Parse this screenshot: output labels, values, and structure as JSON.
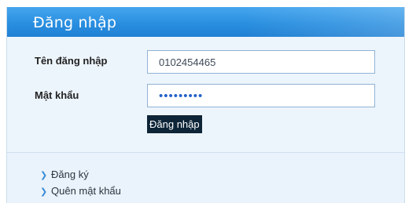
{
  "panel": {
    "title": "Đăng nhập"
  },
  "form": {
    "username_label": "Tên đăng nhập",
    "username_value": "0102454465",
    "password_label": "Mật khẩu",
    "password_value": "•••••••••",
    "submit_label": "Đăng nhập"
  },
  "links": {
    "items": [
      {
        "label": "Đăng ký",
        "icon": "chevron-right-icon"
      },
      {
        "label": "Quên mật khẩu",
        "icon": "chevron-right-icon"
      }
    ]
  },
  "colors": {
    "header": "#2a8fe0",
    "background": "#edf5fc",
    "button": "#0e2538",
    "link_chevron": "#3a8bd6"
  }
}
